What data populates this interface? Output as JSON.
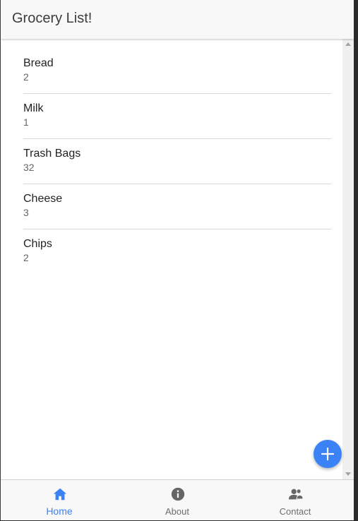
{
  "toolbar": {
    "title": "Grocery List!"
  },
  "items": [
    {
      "name": "Bread",
      "qty": "2"
    },
    {
      "name": "Milk",
      "qty": "1"
    },
    {
      "name": "Trash Bags",
      "qty": "32"
    },
    {
      "name": "Cheese",
      "qty": "3"
    },
    {
      "name": "Chips",
      "qty": "2"
    }
  ],
  "fab": {
    "icon": "plus-icon"
  },
  "tabs": [
    {
      "label": "Home",
      "icon": "home-icon",
      "active": true
    },
    {
      "label": "About",
      "icon": "info-icon",
      "active": false
    },
    {
      "label": "Contact",
      "icon": "people-icon",
      "active": false
    }
  ],
  "colors": {
    "accent": "#3b82f6",
    "inactive": "#6e6e6e"
  }
}
